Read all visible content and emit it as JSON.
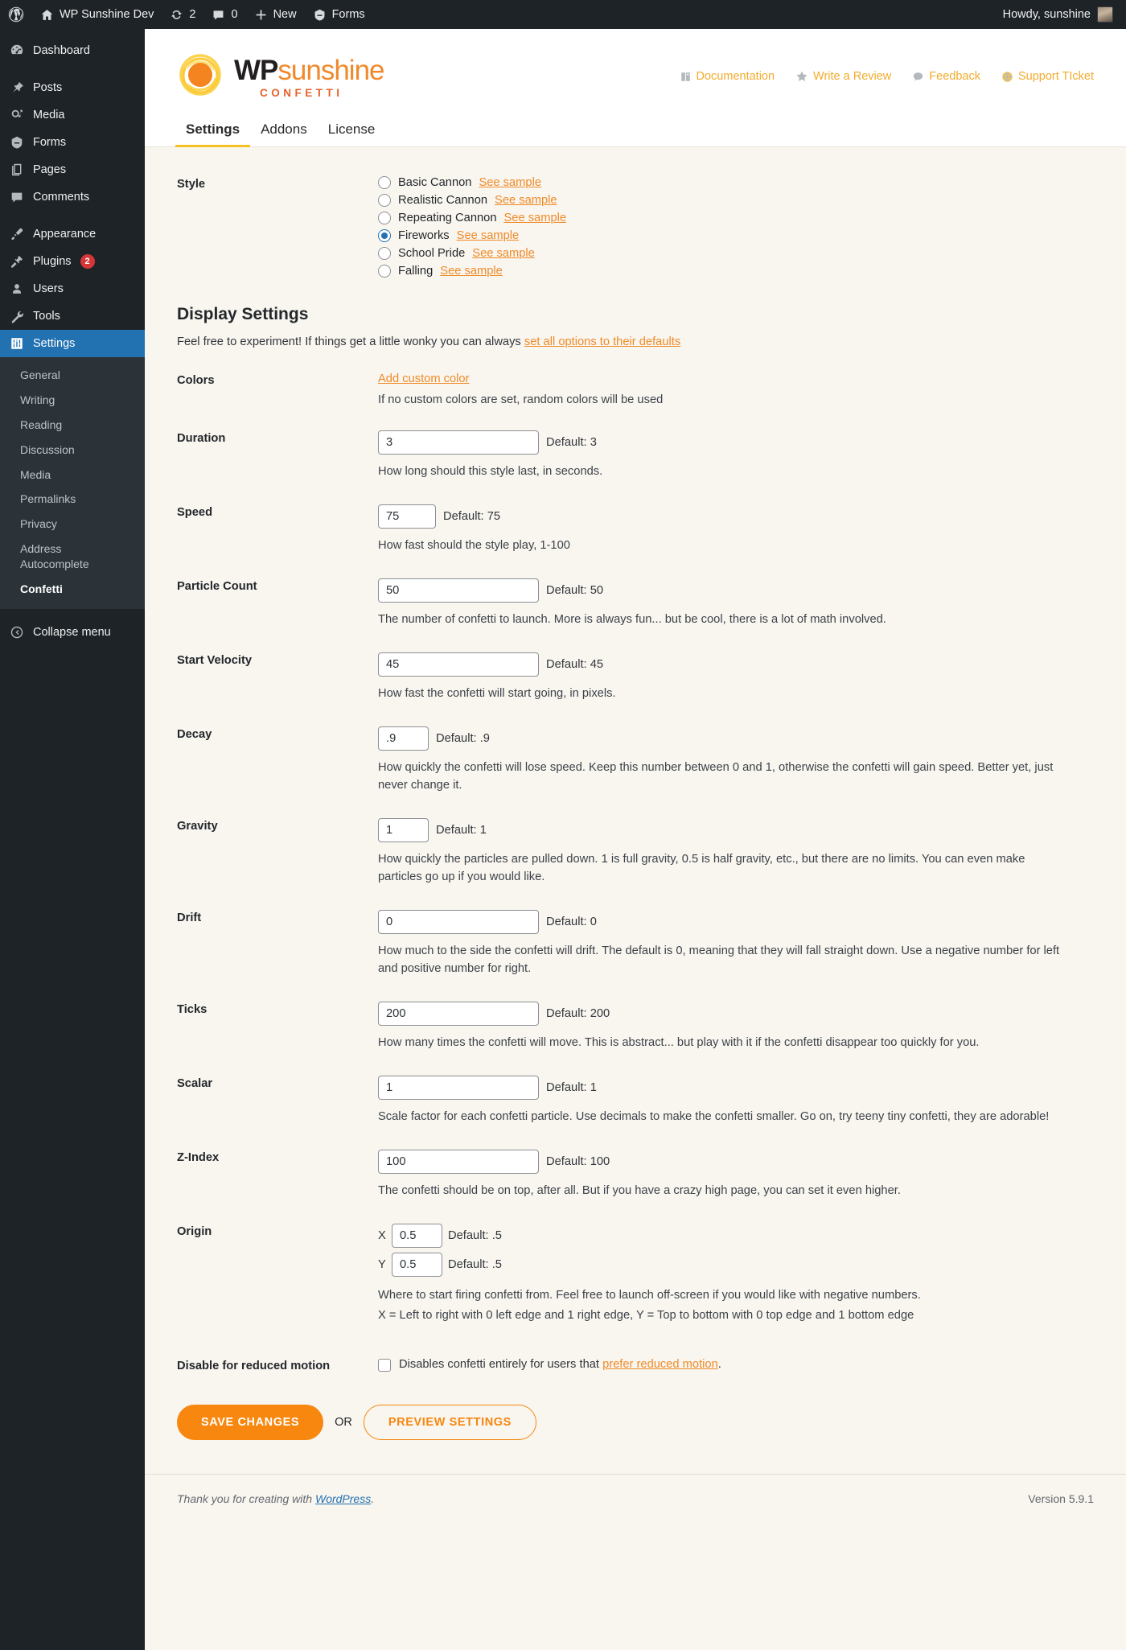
{
  "adminbar": {
    "wp_logo_icon": "wordpress-icon",
    "site_name": "WP Sunshine Dev",
    "site_icon": "home-icon",
    "updates_icon": "updates-icon",
    "updates_count": "2",
    "comments_icon": "comment-icon",
    "comments_count": "0",
    "new_icon": "plus-icon",
    "new_label": "New",
    "forms_icon": "forms-icon",
    "forms_label": "Forms",
    "howdy": "Howdy, sunshine"
  },
  "sidebar": {
    "items": [
      {
        "label": "Dashboard",
        "icon": "dashboard-icon"
      },
      {
        "label": "Posts",
        "icon": "pin-icon"
      },
      {
        "label": "Media",
        "icon": "media-icon"
      },
      {
        "label": "Forms",
        "icon": "forms-icon"
      },
      {
        "label": "Pages",
        "icon": "pages-icon"
      },
      {
        "label": "Comments",
        "icon": "comment-icon"
      },
      {
        "label": "Appearance",
        "icon": "brush-icon"
      },
      {
        "label": "Plugins",
        "icon": "plugin-icon",
        "badge": "2"
      },
      {
        "label": "Users",
        "icon": "user-icon"
      },
      {
        "label": "Tools",
        "icon": "wrench-icon"
      },
      {
        "label": "Settings",
        "icon": "settings-icon",
        "current": true
      }
    ],
    "submenu": [
      "General",
      "Writing",
      "Reading",
      "Discussion",
      "Media",
      "Permalinks",
      "Privacy",
      "Address Autocomplete",
      "Confetti"
    ],
    "submenu_current": "Confetti",
    "collapse_label": "Collapse menu",
    "collapse_icon": "collapse-arrow-icon"
  },
  "header": {
    "logo_wp": "WP",
    "logo_sunshine": "sunshine",
    "logo_sub": "CONFETTI",
    "links": [
      {
        "label": "Documentation",
        "icon": "book-icon"
      },
      {
        "label": "Write a Review",
        "icon": "star-icon"
      },
      {
        "label": "Feedback",
        "icon": "comment-icon"
      },
      {
        "label": "Support TIcket",
        "icon": "lifebuoy-icon"
      }
    ]
  },
  "tabs": [
    {
      "label": "Settings",
      "active": true
    },
    {
      "label": "Addons",
      "active": false
    },
    {
      "label": "License",
      "active": false
    }
  ],
  "style_section": {
    "label": "Style",
    "see_sample": "See sample",
    "options": [
      {
        "label": "Basic Cannon",
        "selected": false
      },
      {
        "label": "Realistic Cannon",
        "selected": false
      },
      {
        "label": "Repeating Cannon",
        "selected": false
      },
      {
        "label": "Fireworks",
        "selected": true
      },
      {
        "label": "School Pride",
        "selected": false
      },
      {
        "label": "Falling",
        "selected": false
      }
    ]
  },
  "display_settings": {
    "heading": "Display Settings",
    "intro_before": "Feel free to experiment! If things get a little wonky you can always ",
    "intro_link": "set all options to their defaults",
    "colors": {
      "label": "Colors",
      "add_link": "Add custom color",
      "hint": "If no custom colors are set, random colors will be used"
    },
    "fields": [
      {
        "label": "Duration",
        "value": "3",
        "default": "Default: 3",
        "size": "lg",
        "hint": "How long should this style last, in seconds."
      },
      {
        "label": "Speed",
        "value": "75",
        "default": "Default: 75",
        "size": "md",
        "hint": "How fast should the style play, 1-100"
      },
      {
        "label": "Particle Count",
        "value": "50",
        "default": "Default: 50",
        "size": "lg",
        "hint": "The number of confetti to launch. More is always fun... but be cool, there is a lot of math involved."
      },
      {
        "label": "Start Velocity",
        "value": "45",
        "default": "Default: 45",
        "size": "lg",
        "hint": "How fast the confetti will start going, in pixels."
      },
      {
        "label": "Decay",
        "value": ".9",
        "default": "Default: .9",
        "size": "sm",
        "hint": "How quickly the confetti will lose speed. Keep this number between 0 and 1, otherwise the confetti will gain speed. Better yet, just never change it."
      },
      {
        "label": "Gravity",
        "value": "1",
        "default": "Default: 1",
        "size": "sm",
        "hint": "How quickly the particles are pulled down. 1 is full gravity, 0.5 is half gravity, etc., but there are no limits. You can even make particles go up if you would like."
      },
      {
        "label": "Drift",
        "value": "0",
        "default": "Default: 0",
        "size": "lg",
        "hint": "How much to the side the confetti will drift. The default is 0, meaning that they will fall straight down. Use a negative number for left and positive number for right."
      },
      {
        "label": "Ticks",
        "value": "200",
        "default": "Default: 200",
        "size": "lg",
        "hint": "How many times the confetti will move. This is abstract... but play with it if the confetti disappear too quickly for you."
      },
      {
        "label": "Scalar",
        "value": "1",
        "default": "Default: 1",
        "size": "lg",
        "hint": "Scale factor for each confetti particle. Use decimals to make the confetti smaller. Go on, try teeny tiny confetti, they are adorable!"
      },
      {
        "label": "Z-Index",
        "value": "100",
        "default": "Default: 100",
        "size": "lg",
        "hint": "The confetti should be on top, after all. But if you have a crazy high page, you can set it even higher."
      }
    ],
    "origin": {
      "label": "Origin",
      "x_axis": "X",
      "x_value": "0.5",
      "x_default": "Default: .5",
      "y_axis": "Y",
      "y_value": "0.5",
      "y_default": "Default: .5",
      "hint_line1": "Where to start firing confetti from. Feel free to launch off-screen if you would like with negative numbers.",
      "hint_line2": "X = Left to right with 0 left edge and 1 right edge, Y = Top to bottom with 0 top edge and 1 bottom edge"
    },
    "reduced_motion": {
      "label": "Disable for reduced motion",
      "text_before": "Disables confetti entirely for users that ",
      "link": "prefer reduced motion",
      "text_after": "."
    }
  },
  "actions": {
    "save_label": "SAVE CHANGES",
    "or_label": "OR",
    "preview_label": "PREVIEW SETTINGS"
  },
  "footer": {
    "thanks_before": "Thank you for creating with ",
    "wordpress_link": "WordPress",
    "thanks_after": ".",
    "version": "Version 5.9.1"
  },
  "colors": {
    "accent_orange": "#f7870f",
    "link_orange": "#ef8b28",
    "header_link": "#f3ab2c",
    "tab_underline": "#f7c223",
    "admin_blue": "#2271b1",
    "badge_red": "#d63638",
    "page_bg": "#f9f5ef"
  }
}
